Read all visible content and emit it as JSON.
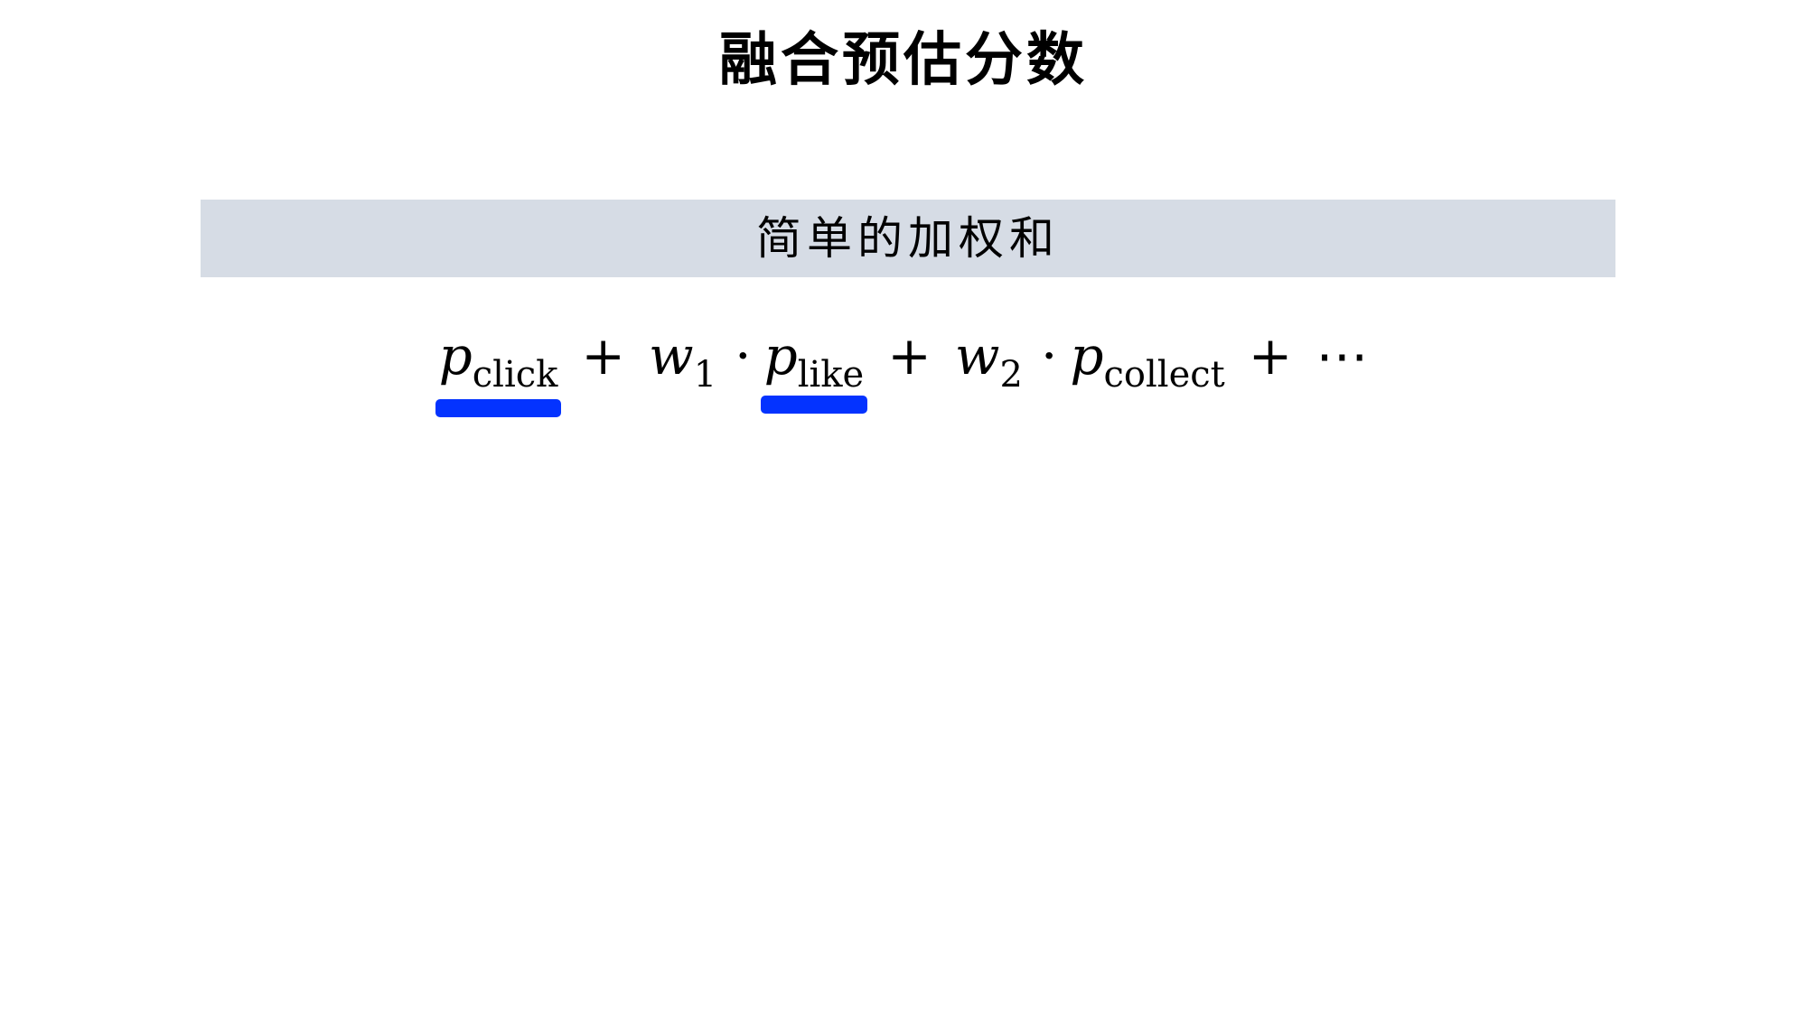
{
  "slide": {
    "title": "融合预估分数",
    "subtitle": "简单的加权和"
  },
  "formula": {
    "p": "p",
    "sub_click": "click",
    "plus": "+",
    "w": "w",
    "sub_1": "1",
    "cdot": "·",
    "sub_like": "like",
    "sub_2": "2",
    "sub_collect": "collect",
    "ellipsis": "⋯"
  },
  "colors": {
    "band": "#d6dce5",
    "highlight": "#0433ff"
  }
}
